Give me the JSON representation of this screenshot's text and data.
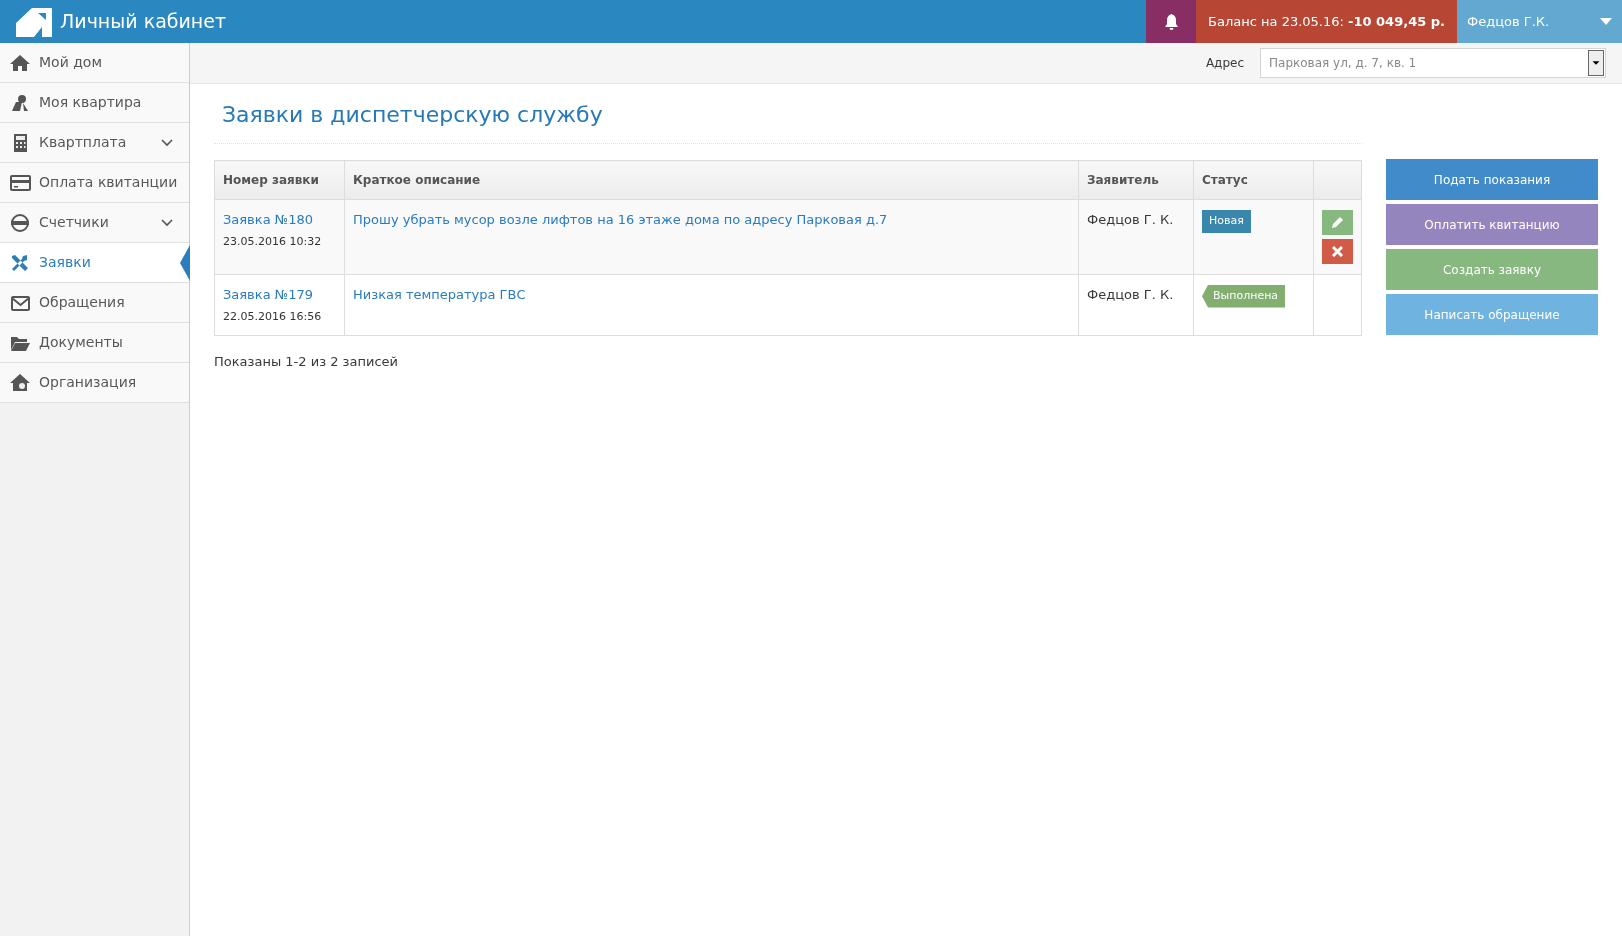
{
  "header": {
    "title": "Личный кабинет",
    "balance_label": "Баланс на 23.05.16:",
    "balance_value": "-10 049,45 р.",
    "user": "Федцов Г.К."
  },
  "sidebar": {
    "items": [
      {
        "label": "Мой дом",
        "selected": false,
        "submenu": false
      },
      {
        "label": "Моя квартира",
        "selected": false,
        "submenu": false
      },
      {
        "label": "Квартплата",
        "selected": false,
        "submenu": true
      },
      {
        "label": "Оплата квитанции",
        "selected": false,
        "submenu": false
      },
      {
        "label": "Счетчики",
        "selected": false,
        "submenu": true
      },
      {
        "label": "Заявки",
        "selected": true,
        "submenu": false
      },
      {
        "label": "Обращения",
        "selected": false,
        "submenu": false
      },
      {
        "label": "Документы",
        "selected": false,
        "submenu": false
      },
      {
        "label": "Организация",
        "selected": false,
        "submenu": false
      }
    ]
  },
  "address": {
    "label": "Адрес",
    "value": "Парковая ул, д. 7, кв. 1"
  },
  "page_title": "Заявки в диспетчерскую службу",
  "table": {
    "columns": [
      "Номер заявки",
      "Краткое описание",
      "Заявитель",
      "Статус"
    ],
    "rows": [
      {
        "number": "Заявка №180",
        "date": "23.05.2016 10:32",
        "description": "Прошу убрать мусор возле лифтов на 16 этаже дома по адресу Парковая д.7",
        "applicant": "Федцов Г. К.",
        "status": {
          "kind": "new",
          "label": "Новая"
        },
        "editable": true
      },
      {
        "number": "Заявка №179",
        "date": "22.05.2016 16:56",
        "description": "Низкая температура ГВС",
        "applicant": "Федцов Г. К.",
        "status": {
          "kind": "done",
          "label": "Выполнена"
        },
        "editable": false
      }
    ]
  },
  "summary": "Показаны 1-2 из 2 записей",
  "actions": [
    {
      "label": "Подать показания",
      "color": "#428bca"
    },
    {
      "label": "Оплатить квитанцию",
      "color": "#9585bf"
    },
    {
      "label": "Создать заявку",
      "color": "#87b87f"
    },
    {
      "label": "Написать обращение",
      "color": "#6fb3e0"
    }
  ]
}
